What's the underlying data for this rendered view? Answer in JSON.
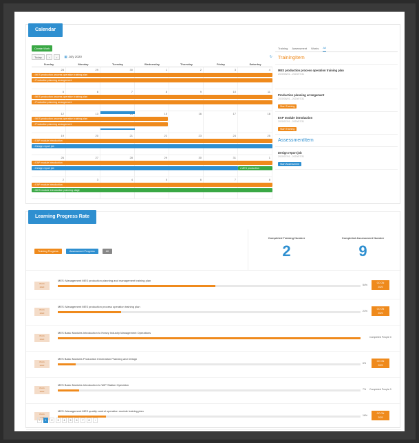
{
  "calendar": {
    "title": "Calendar",
    "create_label": "Create Work",
    "today_label": "Today",
    "prev": "‹",
    "next": "›",
    "month_label": "July 2020",
    "days": [
      "Sunday",
      "Monday",
      "Tuesday",
      "Wednesday",
      "Thursday",
      "Friday",
      "Saturday"
    ],
    "weeks": [
      {
        "dates": [
          "28",
          "29",
          "30",
          "1",
          "2",
          "3",
          "4"
        ]
      },
      {
        "dates": [
          "5",
          "6",
          "7",
          "8",
          "9",
          "10",
          "11"
        ]
      },
      {
        "dates": [
          "12",
          "13",
          "14",
          "15",
          "16",
          "17",
          "18"
        ]
      },
      {
        "dates": [
          "19",
          "20",
          "21",
          "22",
          "23",
          "24",
          "25"
        ]
      },
      {
        "dates": [
          "26",
          "27",
          "28",
          "29",
          "30",
          "31",
          "1"
        ]
      },
      {
        "dates": [
          "2",
          "3",
          "4",
          "5",
          "6",
          "7",
          "8"
        ]
      }
    ],
    "events": {
      "e1": "• MES production process operation training plan",
      "e2": "• Production planning arrangement",
      "e3": "• MES production process operation training plan",
      "e4": "• Production planning arrangement",
      "e5": "• MES production process operation training plan",
      "e6": "• Production planning arrangement",
      "e7": "• EAP module introduction",
      "e8": "• Design report job",
      "e9": "• EAP module introduction",
      "e10": "• Design report job",
      "e11": "• MES production",
      "e12": "• EAP module introduction",
      "e13": "• MES module introduction planning stage"
    }
  },
  "side": {
    "tabs": [
      "Training",
      "Assessment",
      "Works",
      "All"
    ],
    "training_head": "TrainingItem",
    "items": [
      {
        "title": "MES production process operation training plan",
        "date": "2020/05/01 - 2020/07/31",
        "btn": ""
      },
      {
        "title": "Production planning arrangement",
        "date": "2020/06/01 - 2020/07/31",
        "btn": "Start Training"
      },
      {
        "title": "EAP module introduction",
        "date": "2020/07/01 - 2020/07/31",
        "btn": "Start Training"
      }
    ],
    "assessment_head": "AssessmentItem",
    "assess_item": {
      "title": "Design report job",
      "date": "2020/07/01 - 2020/07/31",
      "btn": "Start Assessment"
    }
  },
  "progress": {
    "title": "Learning Progress Rate",
    "btn_training": "Training Progress",
    "btn_assessment": "Assessment Progress",
    "btn_all": "All",
    "stat1_label": "Completed Training Number",
    "stat1_value": "2",
    "stat2_label": "Completed Assessment Number",
    "stat2_value": "9",
    "rows": [
      {
        "date1": "2020",
        "date2": "05-01",
        "title": "MES: Management MES production planning and management training plan",
        "pct": "54%",
        "fill": 0.52,
        "action": "GO ON|2020"
      },
      {
        "date1": "2020",
        "date2": "05-01",
        "title": "MES: Management MES production process operation training plan",
        "pct": "21%",
        "fill": 0.21,
        "action": "GO ON|2020"
      },
      {
        "date1": "2020",
        "date2": "05-01",
        "title": "MES Basic Modules Introduction to Heavy Industry Management Operations",
        "pct": "",
        "fill": 1.0,
        "action": "Completed People 0"
      },
      {
        "date1": "2020",
        "date2": "05-01",
        "title": "MES Basic Modules Production Information Planning and Design",
        "pct": "6%",
        "fill": 0.06,
        "action": "GO ON|2020"
      },
      {
        "date1": "2020",
        "date2": "05-01",
        "title": "MES Basic Modules Introduction to WIP Station Operation",
        "pct": "7%",
        "fill": 0.07,
        "action": "Completed People 0"
      },
      {
        "date1": "2020",
        "date2": "05-01",
        "title": "MES: Management MES quality control operation module training plan",
        "pct": "16%",
        "fill": 0.16,
        "action": "GO ON|2020"
      }
    ],
    "pager": [
      "‹",
      "1",
      "2",
      "3",
      "4",
      "5",
      "6",
      "7",
      "8",
      "›"
    ]
  }
}
